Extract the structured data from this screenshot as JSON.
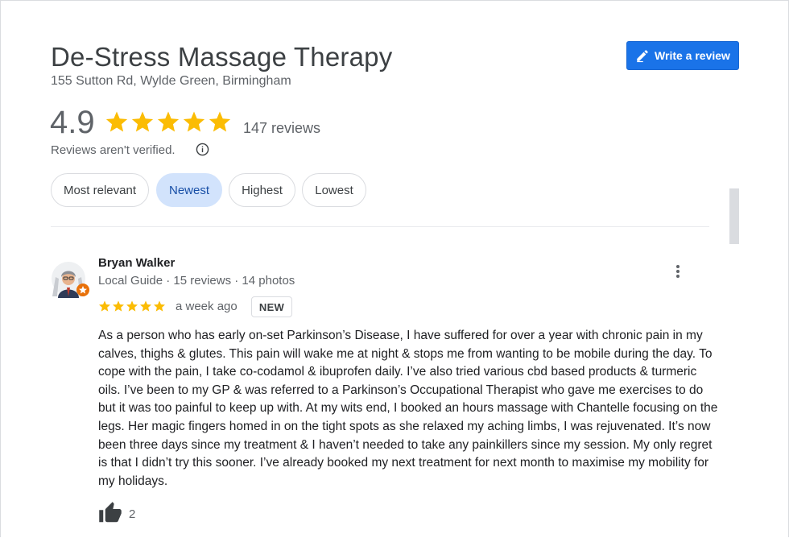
{
  "business": {
    "name": "De-Stress Massage Therapy",
    "address": "155 Sutton Rd, Wylde Green, Birmingham"
  },
  "write_review": {
    "label": "Write a review",
    "icon": "pencil-icon"
  },
  "summary": {
    "rating": "4.9",
    "stars": 5,
    "review_count": "147 reviews",
    "verification_note": "Reviews aren't verified."
  },
  "sort_chips": [
    {
      "label": "Most relevant",
      "selected": false
    },
    {
      "label": "Newest",
      "selected": true
    },
    {
      "label": "Highest",
      "selected": false
    },
    {
      "label": "Lowest",
      "selected": false
    }
  ],
  "review": {
    "author": "Bryan Walker",
    "author_meta": "Local Guide · 15 reviews · 14 photos",
    "stars": 5,
    "date": "a week ago",
    "badge": "NEW",
    "text": "As a person who has early on-set Parkinson’s Disease, I have suffered for over a year with chronic pain in my calves, thighs & glutes. This pain will wake me at night & stops me from wanting to be mobile during the day. To cope with the pain, I take co-codamol & ibuprofen daily. I’ve also tried various cbd based products & turmeric oils. I’ve been to my GP & was referred to a Parkinson’s Occupational Therapist who gave me exercises to do but it was too painful to keep up with. At my wits end, I booked an hours massage with Chantelle focusing on the legs. Her magic fingers homed in on the tight spots as she relaxed my aching limbs, I was rejuvenated. It’s now been three days since my treatment & I haven’t needed to take any painkillers since my session. My only regret is that I didn’t try this sooner. I’ve already booked my next treatment for next month to maximise my mobility for my holidays.",
    "likes": "2"
  },
  "colors": {
    "accent": "#1a73e8",
    "star": "#fbbc04",
    "chip_selected": "#d2e3fc",
    "guide_badge": "#e8710a"
  }
}
